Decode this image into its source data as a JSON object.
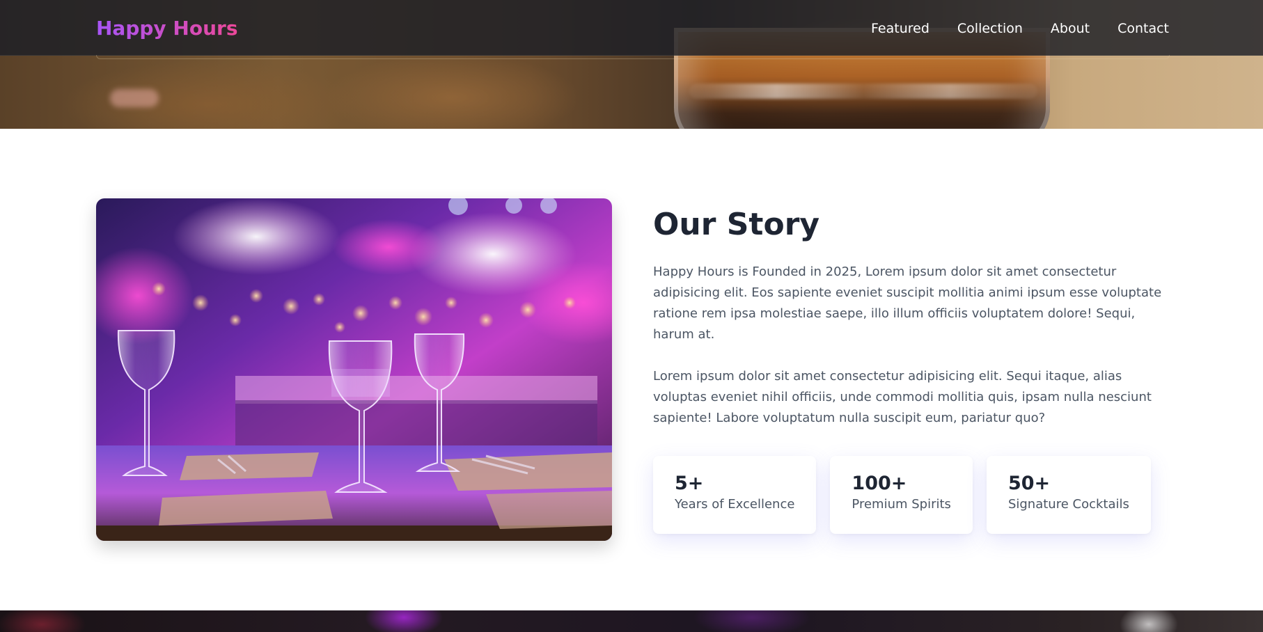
{
  "navbar": {
    "brand": "Happy Hours",
    "links": [
      "Featured",
      "Collection",
      "About",
      "Contact"
    ]
  },
  "about": {
    "image_icon": "wine-glasses-photo",
    "title": "Our Story",
    "paragraphs": [
      "Happy Hours is Founded in 2025, Lorem ipsum dolor sit amet consectetur adipisicing elit. Eos sapiente eveniet suscipit mollitia animi ipsum esse voluptate ratione rem ipsa molestiae saepe, illo illum officiis voluptatem dolore! Sequi, harum at.",
      "Lorem ipsum dolor sit amet consectetur adipisicing elit. Sequi itaque, alias voluptas eveniet nihil officiis, unde commodi mollitia quis, ipsam nulla nesciunt sapiente! Labore voluptatum nulla suscipit eum, pariatur quo?"
    ],
    "stats": [
      {
        "value": "5+",
        "label": "Years of Excellence"
      },
      {
        "value": "100+",
        "label": "Premium Spirits"
      },
      {
        "value": "50+",
        "label": "Signature Cocktails"
      }
    ]
  },
  "colors": {
    "brand_gradient_start": "#a855f7",
    "brand_gradient_end": "#ec4899",
    "heading": "#1e2533",
    "body_text": "#4b5563",
    "navbar_bg": "#1c1e26"
  }
}
